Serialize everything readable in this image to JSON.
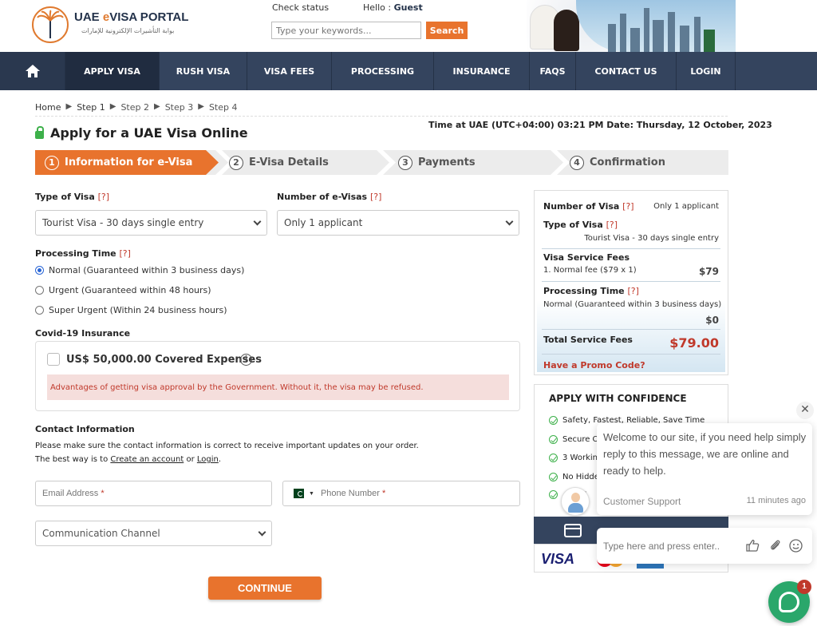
{
  "header": {
    "logo_prefix": "UAE ",
    "logo_e": "e",
    "logo_suffix": "VISA PORTAL",
    "logo_arabic": "بوابة التأشيرات الإلكترونية للإمارات",
    "check_status": "Check status",
    "hello_prefix": "Hello : ",
    "hello_user": "Guest",
    "search_placeholder": "Type your keywords...",
    "search_button": "Search"
  },
  "nav": {
    "items": [
      "APPLY VISA",
      "RUSH VISA",
      "VISA FEES",
      "PROCESSING",
      "INSURANCE",
      "FAQS",
      "CONTACT US",
      "LOGIN"
    ]
  },
  "breadcrumb": [
    "Home",
    "Step 1",
    "Step 2",
    "Step 3",
    "Step 4"
  ],
  "page": {
    "title": "Apply for a UAE Visa Online",
    "time": "Time at UAE (UTC+04:00) 03:21 PM Date: Thursday, 12 October, 2023"
  },
  "steps": [
    {
      "num": "1",
      "label": "Information for e-Visa"
    },
    {
      "num": "2",
      "label": "E-Visa Details"
    },
    {
      "num": "3",
      "label": "Payments"
    },
    {
      "num": "4",
      "label": "Confirmation"
    }
  ],
  "form": {
    "type_label": "Type of Visa",
    "q": "[?]",
    "type_value": "Tourist Visa - 30 days single entry",
    "num_label": "Number of e-Visas",
    "num_value": "Only 1 applicant",
    "proc_label": "Processing Time",
    "proc_options": [
      "Normal (Guaranteed within 3 business days)",
      "Urgent (Guaranteed within 48 hours)",
      "Super Urgent (Within 24 business hours)"
    ],
    "covid_label": "Covid-19 Insurance",
    "covid_text": "US$ 50,000.00 Covered Expenses",
    "covid_info": "i",
    "covid_warn": "Advantages of getting visa approval by the Government. Without it, the visa may be refused.",
    "contact_label": "Contact Information",
    "contact_p1": "Please make sure the contact information is correct to receive important updates on your order.",
    "contact_p2_a": "The best way is to ",
    "contact_p2_link1": "Create an account",
    "contact_p2_or": " or ",
    "contact_p2_link2": "Login",
    "contact_p2_end": ".",
    "email_placeholder": "Email Address",
    "phone_placeholder": "Phone Number",
    "channel_placeholder": "Communication Channel",
    "required_mark": "*",
    "continue": "CONTINUE"
  },
  "summary": {
    "num_label": "Number of Visa",
    "num_value": "Only 1 applicant",
    "type_label": "Type of Visa",
    "type_value": "Tourist Visa - 30 days single entry",
    "fees_label": "Visa Service Fees",
    "fee_line": "1. Normal fee ($79 x 1)",
    "fee_amount": "$79",
    "proc_label": "Processing Time",
    "proc_value": "Normal (Guaranteed within 3 business days)",
    "proc_amount": "$0",
    "total_label": "Total Service Fees",
    "total_amount": "$79.00",
    "promo": "Have a Promo Code?"
  },
  "confidence": {
    "title": "APPLY WITH CONFIDENCE",
    "items": [
      "Safety, Fastest, Reliable, Save Time",
      "Secure O",
      "3 Workin",
      "No Hidde",
      "B"
    ]
  },
  "payment": {
    "visa": "VISA"
  },
  "chat": {
    "message": "Welcome to our site, if you need help simply reply to this message, we are online and ready to help.",
    "agent": "Customer Support",
    "time": "11 minutes ago",
    "input_placeholder": "Type here and press enter..",
    "close": "✕",
    "badge": "1"
  },
  "colors": {
    "accent": "#e8732d",
    "nav": "#34445e",
    "required": "#c0392b",
    "chat": "#2aa76b"
  }
}
